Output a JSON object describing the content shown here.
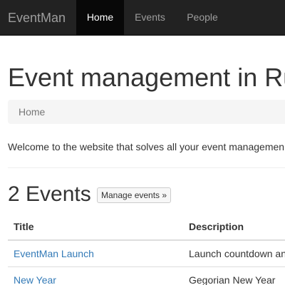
{
  "navbar": {
    "brand": "EventMan",
    "items": [
      {
        "label": "Home",
        "active": true
      },
      {
        "label": "Events",
        "active": false
      },
      {
        "label": "People",
        "active": false
      }
    ]
  },
  "main": {
    "title": "Event management in Ru",
    "breadcrumb": [
      "Home"
    ],
    "welcome": "Welcome to the website that solves all your event managemen",
    "events_count": "2",
    "events_word": "Events",
    "manage_button": "Manage events »",
    "table": {
      "headers": [
        "Title",
        "Description"
      ],
      "rows": [
        {
          "title": "EventMan Launch",
          "description": "Launch countdown an"
        },
        {
          "title": "New Year",
          "description": "Gegorian New Year"
        }
      ]
    }
  },
  "colors": {
    "navbar_bg": "#222222",
    "nav_active_bg": "#080808",
    "link": "#337ab7"
  }
}
